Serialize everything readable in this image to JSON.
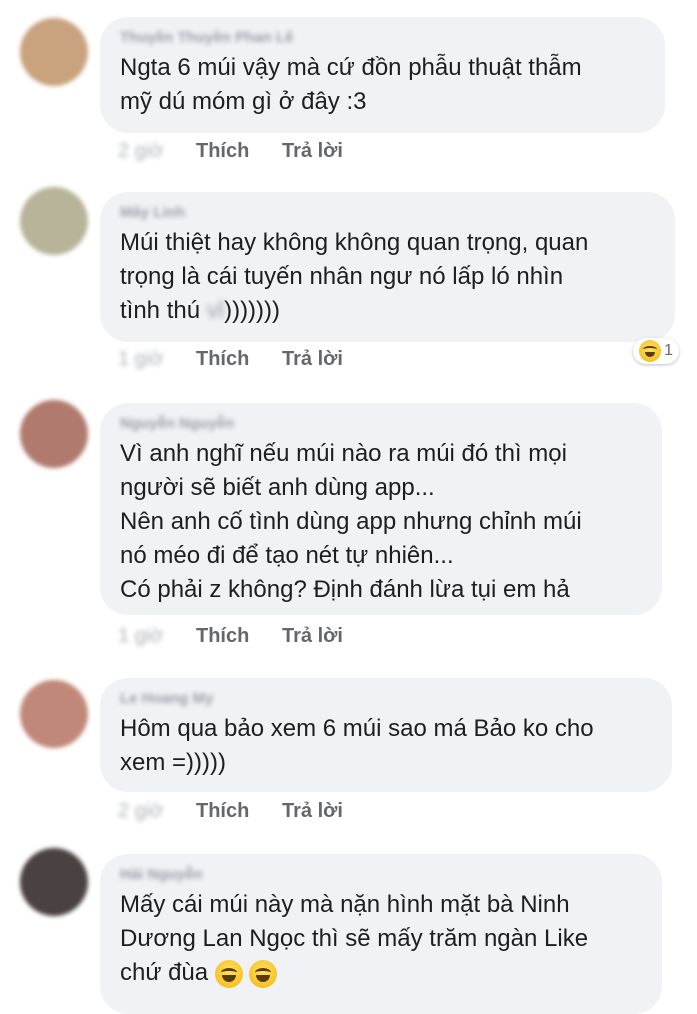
{
  "comments": [
    {
      "author": "Thuyền Thuyền Phan Lê",
      "text": "Ngta 6 múi vậy mà cứ đồn phẫu thuật thẫm\nmỹ dú móm gì ở đây :3",
      "time": "2 giờ",
      "avatar_color": "#c9a27e"
    },
    {
      "author": "Mây Linh",
      "text_before": "Múi thiệt hay không không quan trọng, quan\ntrọng là cái tuyến nhân ngư nó lấp ló nhìn\ntình thú ",
      "text_hidden": "vl",
      "text_after": ")))))))",
      "time": "1 giờ",
      "avatar_color": "#b8b49a",
      "reaction": {
        "icon": "haha-emoji-icon",
        "count": "1"
      }
    },
    {
      "author": "Nguyễn Nguyễn",
      "text": "Vì anh nghĩ nếu múi nào ra múi đó thì mọi\nngười sẽ biết anh dùng app...\nNên anh cố tình dùng app nhưng chỉnh múi\nnó méo đi để tạo nét tự nhiên...\nCó phải z không? Định đánh lừa tụi em hả",
      "time": "1 giờ",
      "avatar_color": "#b07a6e"
    },
    {
      "author": "Le Hoang My",
      "text": "Hôm qua bảo xem 6 múi sao má Bảo ko cho\nxem =)))))",
      "time": "2 giờ",
      "avatar_color": "#c08878"
    },
    {
      "author": "Hải Nguyễn",
      "text": "Mấy cái múi này mà nặn hình mặt bà Ninh\nDương Lan Ngọc thì sẽ mấy trăm ngàn Like\nchứ đùa",
      "time": "",
      "avatar_color": "#4a4240",
      "trailing_emojis": [
        "haha-emoji-icon",
        "haha-emoji-icon"
      ]
    }
  ],
  "actions": {
    "like_label": "Thích",
    "reply_label": "Trả lời"
  }
}
